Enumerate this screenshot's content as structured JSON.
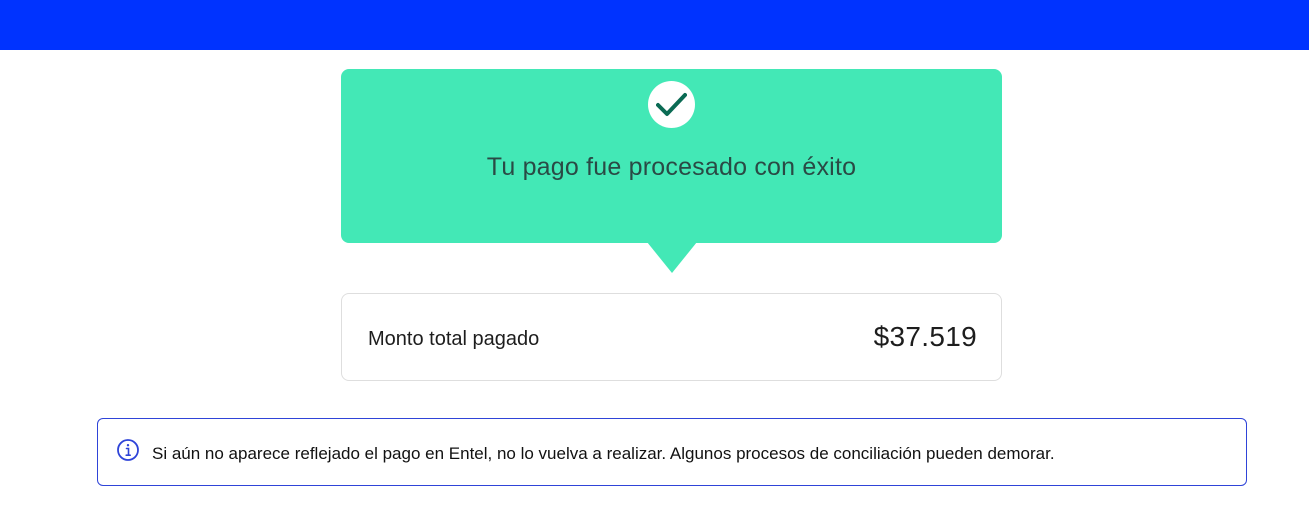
{
  "theme": {
    "header_color": "#0033ff",
    "success_color": "#43e8b6",
    "success_icon_color": "#0b6b54",
    "info_border_color": "#2f44d8"
  },
  "payment_status": {
    "icon": "check-icon",
    "title": "Tu pago fue procesado con éxito"
  },
  "summary": {
    "label": "Monto total pagado",
    "amount": "$37.519"
  },
  "notice": {
    "icon": "info-icon",
    "text": "Si aún no aparece reflejado el pago en Entel, no lo vuelva a realizar. Algunos procesos de conciliación pueden demorar."
  }
}
